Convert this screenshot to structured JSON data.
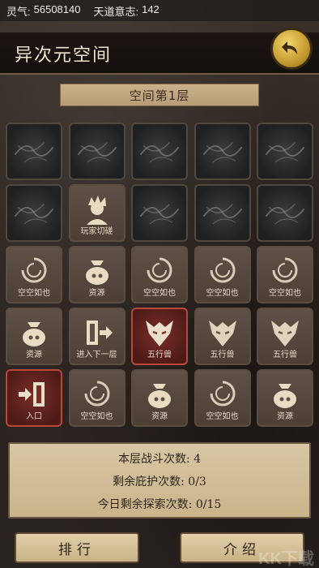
{
  "status": {
    "lingqi_label": "灵气:",
    "lingqi_value": "56508140",
    "tiandao_label": "天道意志:",
    "tiandao_value": "142"
  },
  "header": {
    "title": "异次元空间"
  },
  "floor": {
    "label": "空间第1层"
  },
  "grid": [
    [
      "",
      "",
      "",
      "",
      ""
    ],
    [
      "",
      "玩家切磋",
      "",
      "",
      ""
    ],
    [
      "空空如也",
      "资源",
      "空空如也",
      "空空如也",
      "空空如也"
    ],
    [
      "资源",
      "进入下一层",
      "五行兽",
      "五行兽",
      "五行兽"
    ],
    [
      "入口",
      "空空如也",
      "资源",
      "空空如也",
      "资源"
    ]
  ],
  "info": {
    "battle": "本层战斗次数: 4",
    "shelter": "剩余庇护次数: 0/3",
    "explore": "今日剩余探索次数: 0/15"
  },
  "buttons": {
    "rank": "排行",
    "intro": "介绍"
  },
  "watermark": "KK下载",
  "colors": {
    "accent_gold": "#c49a2f",
    "red_tile": "#7a2e26",
    "panel": "#d8c7a4"
  }
}
